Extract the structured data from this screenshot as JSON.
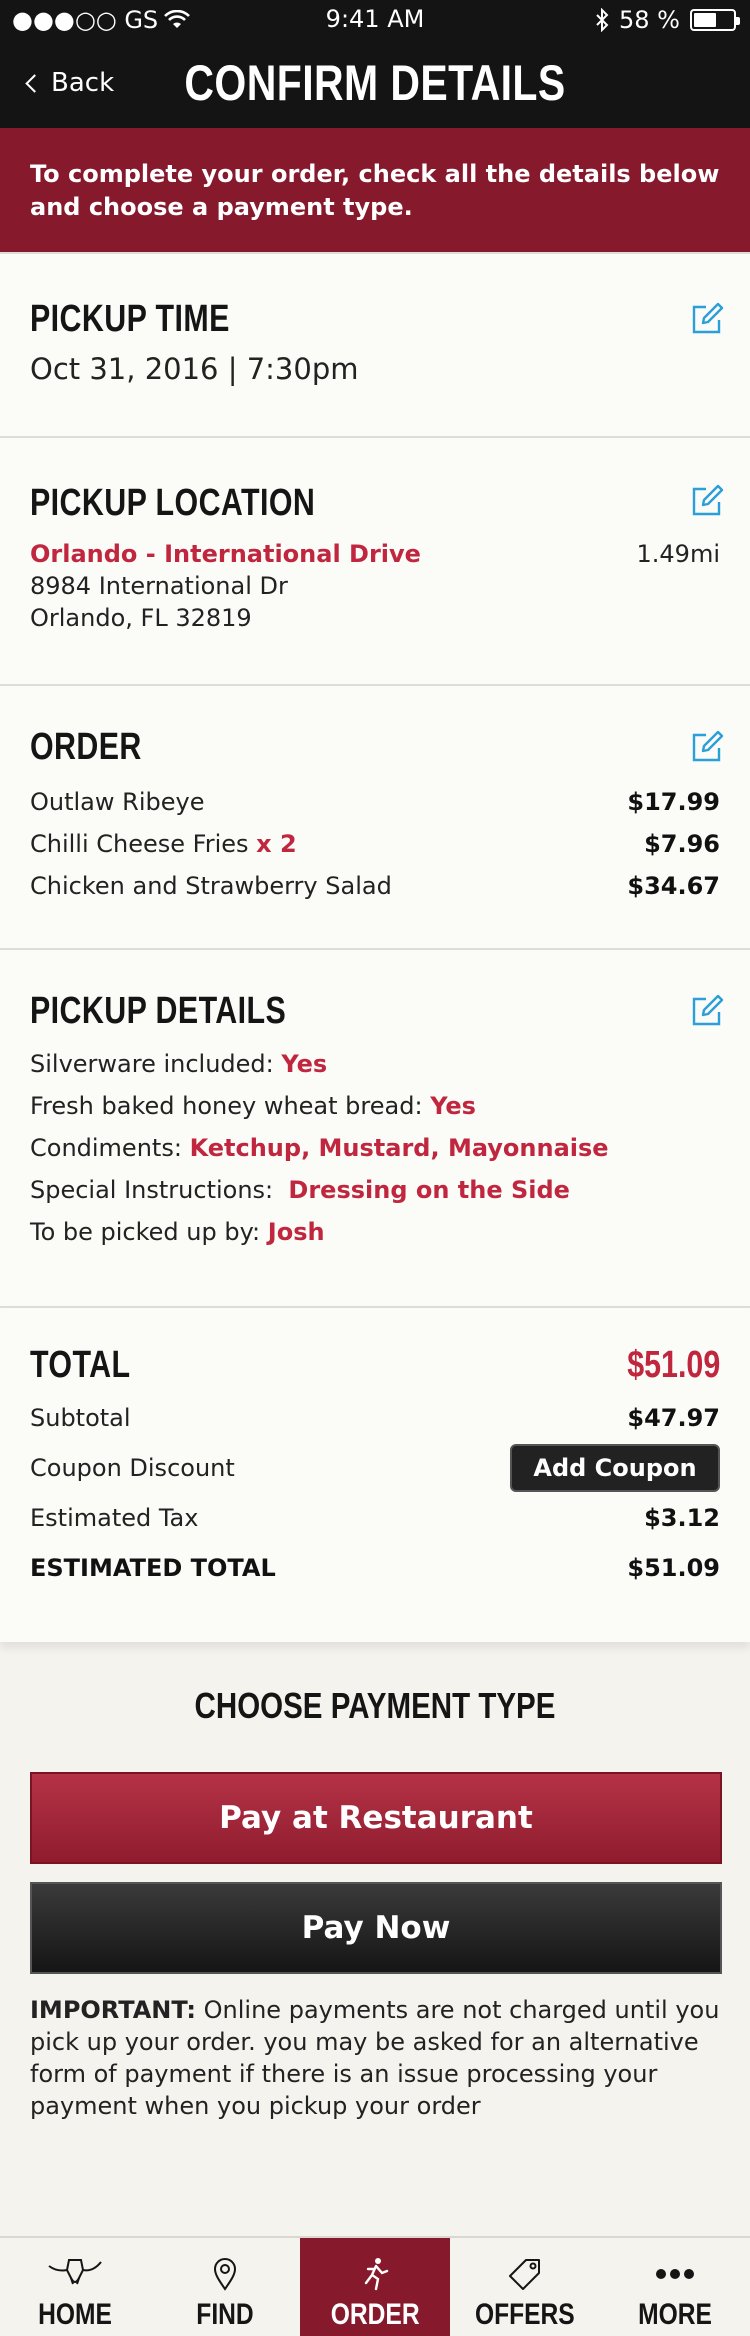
{
  "status_bar": {
    "carrier": "●●●○○ GS",
    "time": "9:41 AM",
    "battery": "58 %",
    "battery_level": 0.58
  },
  "nav": {
    "back_label": "Back",
    "title": "CONFIRM DETAILS"
  },
  "banner": {
    "text": "To complete your order, check all the details below and choose a payment type."
  },
  "pickup_time": {
    "heading": "PICKUP TIME",
    "value": "Oct 31, 2016 | 7:30pm"
  },
  "pickup_location": {
    "heading": "PICKUP LOCATION",
    "name": "Orlando - International Drive",
    "distance": "1.49mi",
    "address_line1": "8984 International Dr",
    "address_line2": "Orlando, FL 32819"
  },
  "order": {
    "heading": "ORDER",
    "items": [
      {
        "name": "Outlaw Ribeye",
        "qty": "",
        "price": "$17.99"
      },
      {
        "name": "Chilli Cheese Fries",
        "qty": "x 2",
        "price": "$7.96"
      },
      {
        "name": "Chicken and Strawberry Salad",
        "qty": "",
        "price": "$34.67"
      }
    ]
  },
  "pickup_details": {
    "heading": "PICKUP DETAILS",
    "rows": [
      {
        "label": "Silverware included:",
        "value": "Yes"
      },
      {
        "label": "Fresh baked honey wheat bread:",
        "value": "Yes"
      },
      {
        "label": "Condiments:",
        "value": "Ketchup, Mustard, Mayonnaise"
      },
      {
        "label": "Special Instructions:",
        "value": "Dressing on the Side"
      },
      {
        "label": "To be picked up by:",
        "value": "Josh"
      }
    ]
  },
  "total": {
    "heading": "TOTAL",
    "amount": "$51.09",
    "subtotal_label": "Subtotal",
    "subtotal": "$47.97",
    "coupon_label": "Coupon Discount",
    "coupon_button": "Add Coupon",
    "tax_label": "Estimated Tax",
    "tax": "$3.12",
    "estimated_total_label": "ESTIMATED TOTAL",
    "estimated_total": "$51.09"
  },
  "payment": {
    "title": "CHOOSE PAYMENT TYPE",
    "pay_restaurant": "Pay at Restaurant",
    "pay_now": "Pay Now",
    "important_label": "IMPORTANT:",
    "important_text": " Online payments are not charged until you pick up your order.  you may be asked for an alternative form of payment if there is an issue processing your payment when you pickup your order"
  },
  "tabs": [
    {
      "label": "HOME",
      "icon": "longhorn-icon"
    },
    {
      "label": "FIND",
      "icon": "location-pin-icon"
    },
    {
      "label": "ORDER",
      "icon": "running-person-icon"
    },
    {
      "label": "OFFERS",
      "icon": "tag-icon"
    },
    {
      "label": "MORE",
      "icon": "more-dots-icon"
    }
  ],
  "colors": {
    "accent": "#87192d",
    "red_text": "#c0263e",
    "edit_icon": "#2a9fd8"
  }
}
